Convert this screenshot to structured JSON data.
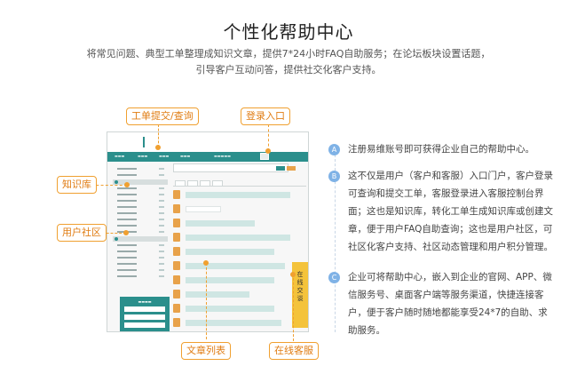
{
  "header": {
    "title": "个性化帮助中心",
    "subtitle_line1": "将常见问题、典型工单整理成知识文章，提供7*24小时FAQ自助服务；在论坛板块设置话题，",
    "subtitle_line2": "引导客户互动问答，提供社交化客户支持。"
  },
  "callouts": {
    "ticket_query": "工单提交/查询",
    "login_entry": "登录入口",
    "knowledge_base": "知识库",
    "user_community": "用户社区",
    "article_list": "文章列表",
    "online_support": "在线客服"
  },
  "mockup": {
    "chat_tab": "在线交谈"
  },
  "features": [
    {
      "badge": "A",
      "text": "注册易维账号即可获得企业自己的帮助中心。"
    },
    {
      "badge": "B",
      "text": "这不仅是用户（客户和客服）入口门户，客户登录可查询和提交工单，客服登录进入客服控制台界面；这也是知识库，转化工单生成知识库或创建文章，便于用户FAQ自助查询；这也是用户社区，可社区化客户支持、社区动态管理和用户积分管理。"
    },
    {
      "badge": "C",
      "text": "企业可将帮助中心，嵌入到企业的官网、APP、微信服务号、桌面客户端等服务渠道，快捷连接客户，便于客户随时随地都能享受24*7的自助、求助服务。"
    }
  ],
  "colors": {
    "accent": "#f0a030",
    "brand_teal": "#2b8f8c",
    "badge_blue": "#7fb2e6"
  }
}
